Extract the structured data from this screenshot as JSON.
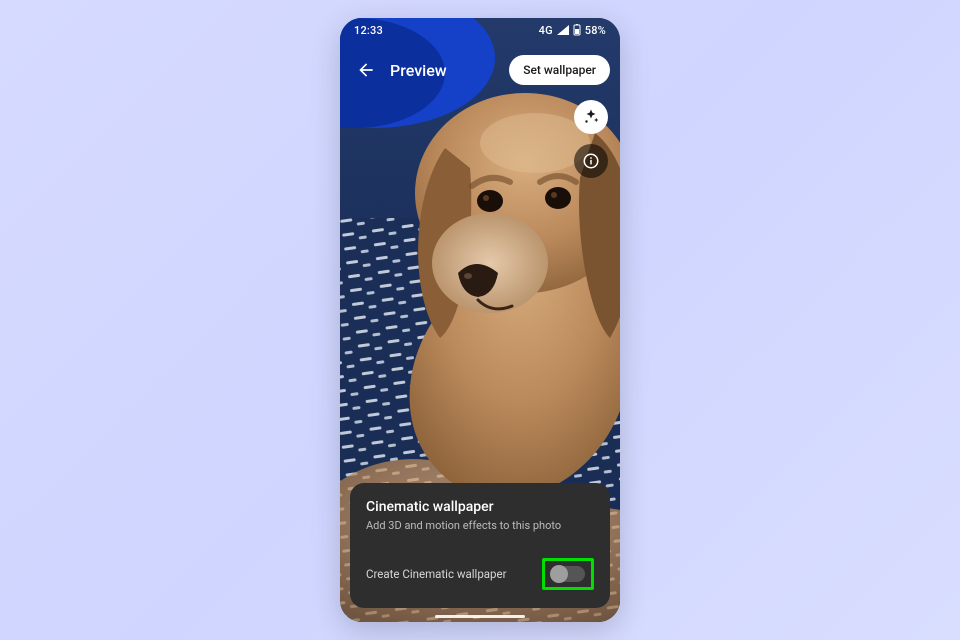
{
  "status": {
    "time": "12:33",
    "network": "4G",
    "battery_pct": "58%"
  },
  "header": {
    "title": "Preview",
    "action_label": "Set wallpaper"
  },
  "buttons": {
    "effects_icon": "sparkle-icon",
    "info_icon": "info-icon"
  },
  "card": {
    "title": "Cinematic wallpaper",
    "subtitle": "Add 3D and motion effects to this photo",
    "toggle_label": "Create Cinematic wallpaper",
    "toggle_on": false
  },
  "colors": {
    "highlight": "#00e000",
    "page_bg": "#d6daff",
    "card_bg": "#2e2e2e"
  }
}
